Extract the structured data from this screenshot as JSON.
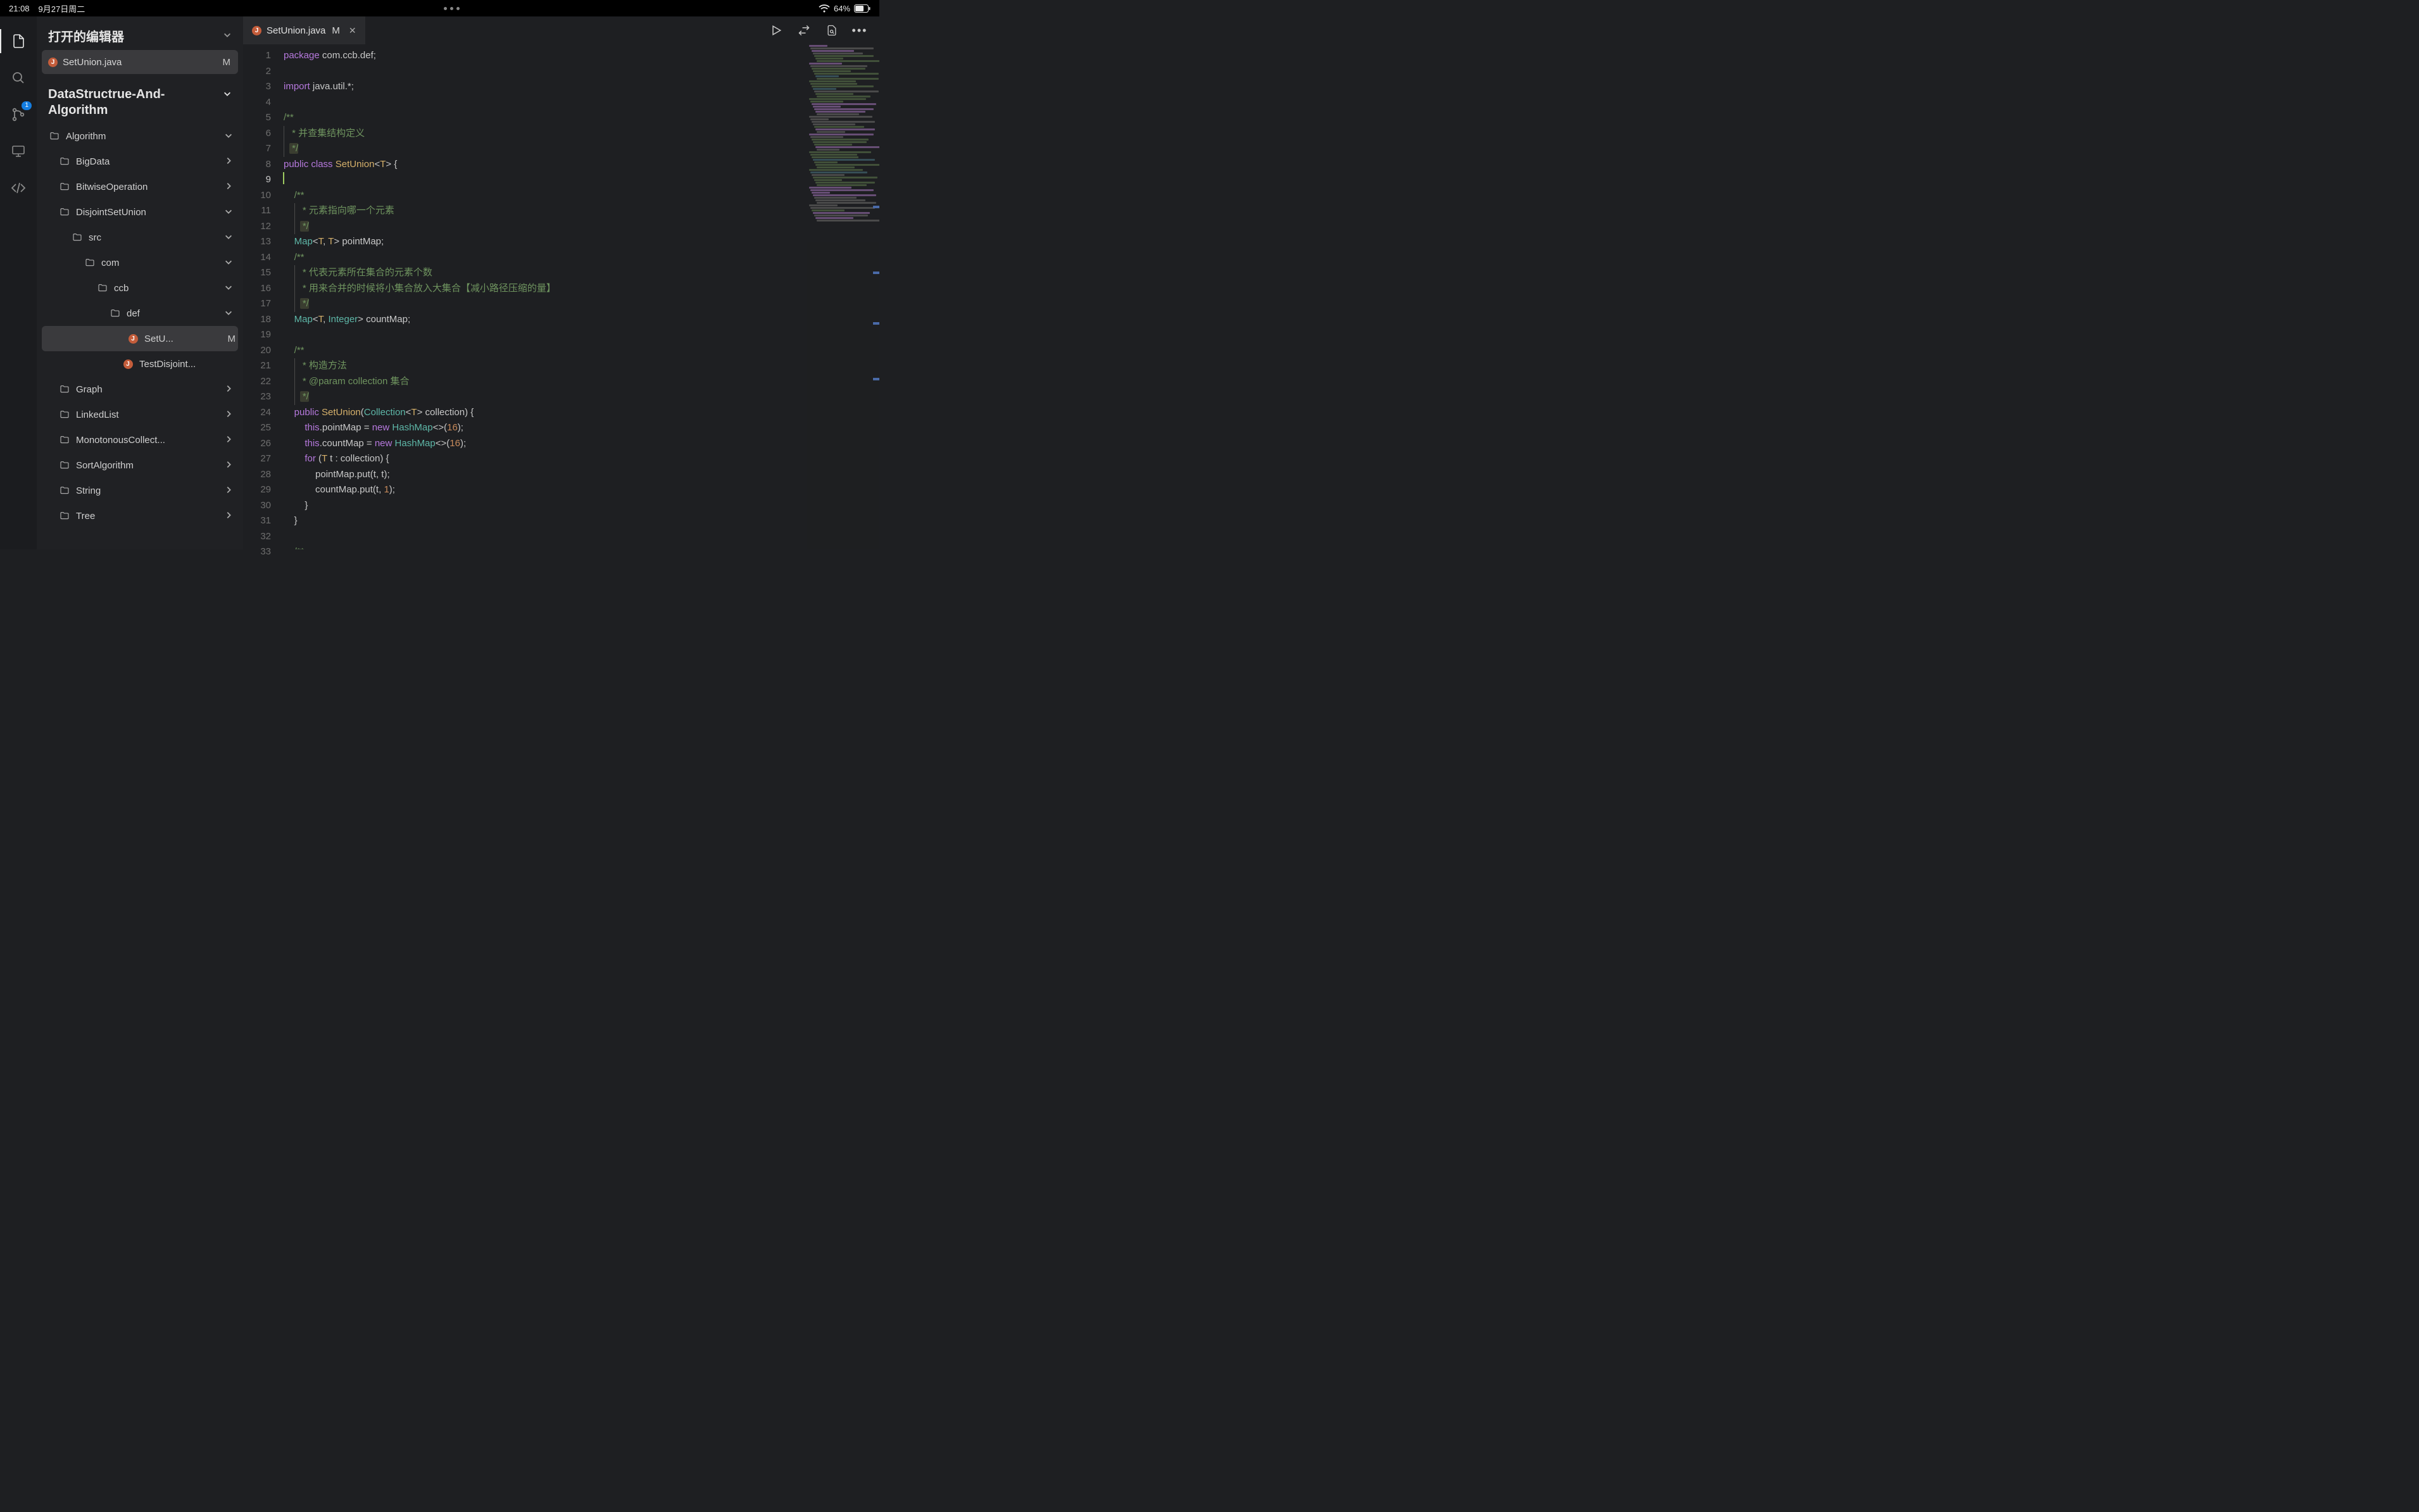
{
  "status": {
    "time": "21:08",
    "date": "9月27日周二",
    "battery": "64%"
  },
  "activity": {
    "scm_badge": "1"
  },
  "sidebar": {
    "open_editors_title": "打开的编辑器",
    "open_editors": [
      {
        "name": "SetUnion.java",
        "modified": "M"
      }
    ],
    "project_title": "DataStructrue-And-Algorithm",
    "tree": [
      {
        "label": "Algorithm",
        "depth": 0,
        "type": "folder",
        "expand": "down"
      },
      {
        "label": "BigData",
        "depth": 1,
        "type": "folder",
        "expand": "right"
      },
      {
        "label": "BitwiseOperation",
        "depth": 1,
        "type": "folder",
        "expand": "right"
      },
      {
        "label": "DisjointSetUnion",
        "depth": 1,
        "type": "folder",
        "expand": "down"
      },
      {
        "label": "src",
        "depth": 2,
        "type": "folder",
        "expand": "down"
      },
      {
        "label": "com",
        "depth": 3,
        "type": "folder",
        "expand": "down"
      },
      {
        "label": "ccb",
        "depth": 4,
        "type": "folder",
        "expand": "down"
      },
      {
        "label": "def",
        "depth": 5,
        "type": "folder",
        "expand": "down"
      },
      {
        "label": "SetU...",
        "depth": 6,
        "type": "java",
        "selected": true,
        "modified": "M"
      },
      {
        "label": "TestDisjoint...",
        "depth": 6,
        "type": "java"
      },
      {
        "label": "Graph",
        "depth": 1,
        "type": "folder",
        "expand": "right"
      },
      {
        "label": "LinkedList",
        "depth": 1,
        "type": "folder",
        "expand": "right"
      },
      {
        "label": "MonotonousCollect...",
        "depth": 1,
        "type": "folder",
        "expand": "right"
      },
      {
        "label": "SortAlgorithm",
        "depth": 1,
        "type": "folder",
        "expand": "right"
      },
      {
        "label": "String",
        "depth": 1,
        "type": "folder",
        "expand": "right"
      },
      {
        "label": "Tree",
        "depth": 1,
        "type": "folder",
        "expand": "right"
      }
    ]
  },
  "tab": {
    "file": "SetUnion.java",
    "modified": "M"
  },
  "code": {
    "current_line": 9,
    "lines": [
      {
        "n": 1,
        "t": [
          [
            "kw",
            "package"
          ],
          [
            "pun",
            " "
          ],
          [
            "ns",
            "com"
          ],
          [
            "pun",
            "."
          ],
          [
            "ns",
            "ccb"
          ],
          [
            "pun",
            "."
          ],
          [
            "ns",
            "def"
          ],
          [
            "pun",
            ";"
          ]
        ]
      },
      {
        "n": 2,
        "t": []
      },
      {
        "n": 3,
        "t": [
          [
            "kw",
            "import"
          ],
          [
            "pun",
            " "
          ],
          [
            "ns",
            "java"
          ],
          [
            "pun",
            "."
          ],
          [
            "ns",
            "util"
          ],
          [
            "pun",
            ".*;"
          ]
        ]
      },
      {
        "n": 4,
        "t": []
      },
      {
        "n": 5,
        "t": [
          [
            "cmt",
            "/**"
          ]
        ]
      },
      {
        "n": 6,
        "t": [
          [
            "cmt",
            " * 并查集结构定义"
          ]
        ],
        "border": true
      },
      {
        "n": 7,
        "t": [
          [
            "cmt-hl",
            " */"
          ]
        ],
        "border": true
      },
      {
        "n": 8,
        "t": [
          [
            "kw",
            "public"
          ],
          [
            "pun",
            " "
          ],
          [
            "kw",
            "class"
          ],
          [
            "pun",
            " "
          ],
          [
            "cls",
            "SetUnion"
          ],
          [
            "pun",
            "<"
          ],
          [
            "gen",
            "T"
          ],
          [
            "pun",
            "> {"
          ]
        ]
      },
      {
        "n": 9,
        "t": [],
        "caret": true
      },
      {
        "n": 10,
        "indent": 1,
        "t": [
          [
            "cmt",
            "/**"
          ]
        ]
      },
      {
        "n": 11,
        "indent": 1,
        "t": [
          [
            "cmt",
            " * 元素指向哪一个元素"
          ]
        ],
        "border": true
      },
      {
        "n": 12,
        "indent": 1,
        "t": [
          [
            "cmt-hl",
            " */"
          ]
        ],
        "border": true
      },
      {
        "n": 13,
        "indent": 1,
        "t": [
          [
            "typ",
            "Map"
          ],
          [
            "pun",
            "<"
          ],
          [
            "gen",
            "T"
          ],
          [
            "pun",
            ", "
          ],
          [
            "gen",
            "T"
          ],
          [
            "pun",
            "> "
          ],
          [
            "ns",
            "pointMap"
          ],
          [
            "pun",
            ";"
          ]
        ]
      },
      {
        "n": 14,
        "indent": 1,
        "t": [
          [
            "cmt",
            "/**"
          ]
        ]
      },
      {
        "n": 15,
        "indent": 1,
        "t": [
          [
            "cmt",
            " * 代表元素所在集合的元素个数"
          ]
        ],
        "border": true
      },
      {
        "n": 16,
        "indent": 1,
        "t": [
          [
            "cmt",
            " * 用来合并的时候将小集合放入大集合【减小路径压缩的量】"
          ]
        ],
        "border": true
      },
      {
        "n": 17,
        "indent": 1,
        "t": [
          [
            "cmt-hl",
            " */"
          ]
        ],
        "border": true
      },
      {
        "n": 18,
        "indent": 1,
        "t": [
          [
            "typ",
            "Map"
          ],
          [
            "pun",
            "<"
          ],
          [
            "gen",
            "T"
          ],
          [
            "pun",
            ", "
          ],
          [
            "typ",
            "Integer"
          ],
          [
            "pun",
            "> "
          ],
          [
            "ns",
            "countMap"
          ],
          [
            "pun",
            ";"
          ]
        ]
      },
      {
        "n": 19,
        "t": []
      },
      {
        "n": 20,
        "indent": 1,
        "t": [
          [
            "cmt",
            "/**"
          ]
        ]
      },
      {
        "n": 21,
        "indent": 1,
        "t": [
          [
            "cmt",
            " * 构造方法"
          ]
        ],
        "border": true
      },
      {
        "n": 22,
        "indent": 1,
        "t": [
          [
            "cmt",
            " * "
          ],
          [
            "doca",
            "@param"
          ],
          [
            "cmt",
            " collection 集合"
          ]
        ],
        "border": true
      },
      {
        "n": 23,
        "indent": 1,
        "t": [
          [
            "cmt-hl",
            " */"
          ]
        ],
        "border": true
      },
      {
        "n": 24,
        "indent": 1,
        "t": [
          [
            "kw",
            "public"
          ],
          [
            "pun",
            " "
          ],
          [
            "cls",
            "SetUnion"
          ],
          [
            "pun",
            "("
          ],
          [
            "typ",
            "Collection"
          ],
          [
            "pun",
            "<"
          ],
          [
            "gen",
            "T"
          ],
          [
            "pun",
            "> "
          ],
          [
            "ns",
            "collection"
          ],
          [
            "pun",
            ") {"
          ]
        ]
      },
      {
        "n": 25,
        "indent": 2,
        "t": [
          [
            "kw",
            "this"
          ],
          [
            "pun",
            "."
          ],
          [
            "ns",
            "pointMap"
          ],
          [
            "pun",
            " = "
          ],
          [
            "kw",
            "new"
          ],
          [
            "pun",
            " "
          ],
          [
            "typ",
            "HashMap"
          ],
          [
            "pun",
            "<>("
          ],
          [
            "num",
            "16"
          ],
          [
            "pun",
            ");"
          ]
        ]
      },
      {
        "n": 26,
        "indent": 2,
        "t": [
          [
            "kw",
            "this"
          ],
          [
            "pun",
            "."
          ],
          [
            "ns",
            "countMap"
          ],
          [
            "pun",
            " = "
          ],
          [
            "kw",
            "new"
          ],
          [
            "pun",
            " "
          ],
          [
            "typ",
            "HashMap"
          ],
          [
            "pun",
            "<>("
          ],
          [
            "num",
            "16"
          ],
          [
            "pun",
            ");"
          ]
        ]
      },
      {
        "n": 27,
        "indent": 2,
        "t": [
          [
            "kw",
            "for"
          ],
          [
            "pun",
            " ("
          ],
          [
            "gen",
            "T"
          ],
          [
            "pun",
            " "
          ],
          [
            "ns",
            "t"
          ],
          [
            "pun",
            " : "
          ],
          [
            "ns",
            "collection"
          ],
          [
            "pun",
            ") {"
          ]
        ]
      },
      {
        "n": 28,
        "indent": 3,
        "t": [
          [
            "ns",
            "pointMap"
          ],
          [
            "pun",
            "."
          ],
          [
            "ns",
            "put"
          ],
          [
            "pun",
            "("
          ],
          [
            "ns",
            "t"
          ],
          [
            "pun",
            ", "
          ],
          [
            "ns",
            "t"
          ],
          [
            "pun",
            ");"
          ]
        ]
      },
      {
        "n": 29,
        "indent": 3,
        "t": [
          [
            "ns",
            "countMap"
          ],
          [
            "pun",
            "."
          ],
          [
            "ns",
            "put"
          ],
          [
            "pun",
            "("
          ],
          [
            "ns",
            "t"
          ],
          [
            "pun",
            ", "
          ],
          [
            "num",
            "1"
          ],
          [
            "pun",
            ");"
          ]
        ]
      },
      {
        "n": 30,
        "indent": 2,
        "t": [
          [
            "pun",
            "}"
          ]
        ]
      },
      {
        "n": 31,
        "indent": 1,
        "t": [
          [
            "pun",
            "}"
          ]
        ]
      },
      {
        "n": 32,
        "t": []
      },
      {
        "n": 33,
        "indent": 1,
        "t": [
          [
            "cmt",
            "/**"
          ]
        ]
      }
    ]
  }
}
